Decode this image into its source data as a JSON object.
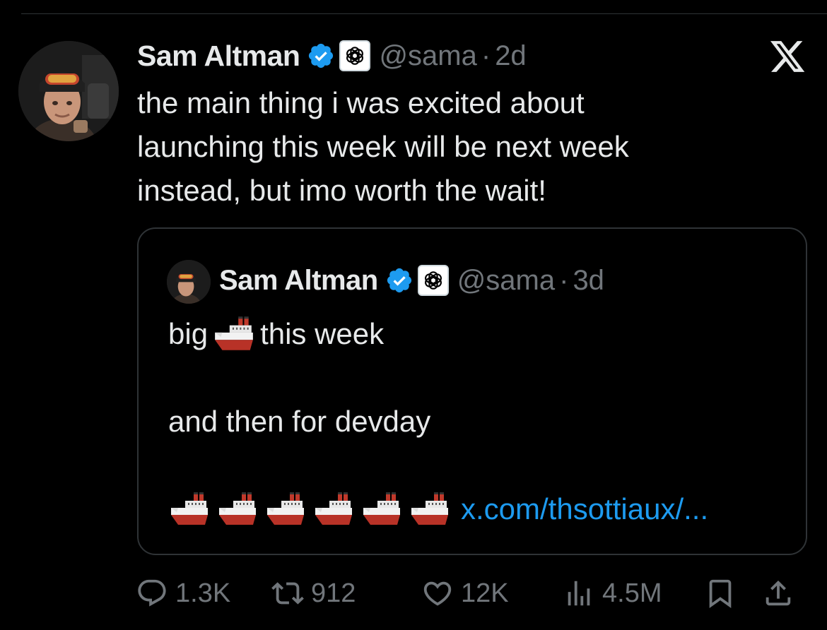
{
  "tweet": {
    "author_name": "Sam Altman",
    "handle": "@sama",
    "separator": "·",
    "time": "2d",
    "text": "the main thing i was excited about\nlaunching this week will be next week\ninstead, but imo worth the wait!"
  },
  "quote": {
    "author_name": "Sam Altman",
    "handle": "@sama",
    "separator": "·",
    "time": "3d",
    "line1_before": "big",
    "line1_after": "this week",
    "line2": "and then for devday",
    "ship_count": 6,
    "link": "x.com/thsottiaux/..."
  },
  "actions": {
    "replies": "1.3K",
    "reposts": "912",
    "likes": "12K",
    "views": "4.5M"
  },
  "icons": {
    "verified": "verified-badge-icon",
    "affiliation": "openai-logo-icon",
    "close": "x-logo-icon",
    "reply": "reply-icon",
    "repost": "repost-icon",
    "like": "heart-icon",
    "views": "views-icon",
    "bookmark": "bookmark-icon",
    "share": "share-icon"
  },
  "colors": {
    "background": "#000000",
    "text": "#e7e9ea",
    "muted": "#71767b",
    "link": "#1d9bf0",
    "verified": "#1d9bf0",
    "border": "#2f3336"
  }
}
